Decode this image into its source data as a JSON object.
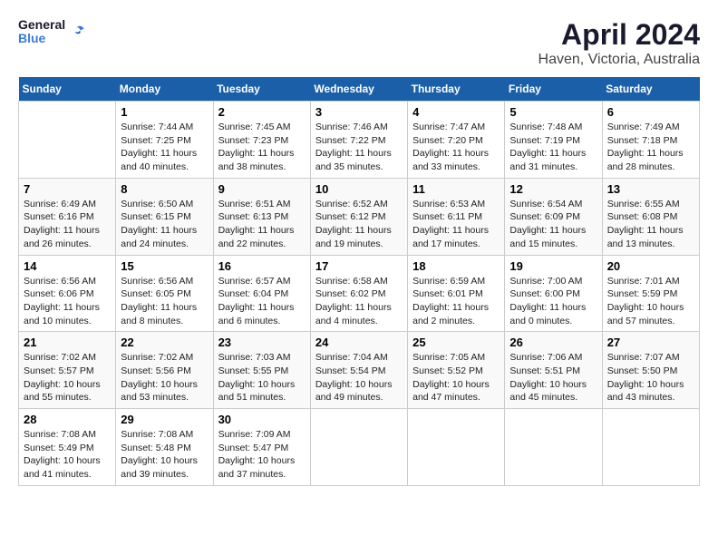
{
  "header": {
    "logo_line1": "General",
    "logo_line2": "Blue",
    "title": "April 2024",
    "subtitle": "Haven, Victoria, Australia"
  },
  "weekdays": [
    "Sunday",
    "Monday",
    "Tuesday",
    "Wednesday",
    "Thursday",
    "Friday",
    "Saturday"
  ],
  "weeks": [
    [
      {
        "day": "",
        "info": ""
      },
      {
        "day": "1",
        "info": "Sunrise: 7:44 AM\nSunset: 7:25 PM\nDaylight: 11 hours\nand 40 minutes."
      },
      {
        "day": "2",
        "info": "Sunrise: 7:45 AM\nSunset: 7:23 PM\nDaylight: 11 hours\nand 38 minutes."
      },
      {
        "day": "3",
        "info": "Sunrise: 7:46 AM\nSunset: 7:22 PM\nDaylight: 11 hours\nand 35 minutes."
      },
      {
        "day": "4",
        "info": "Sunrise: 7:47 AM\nSunset: 7:20 PM\nDaylight: 11 hours\nand 33 minutes."
      },
      {
        "day": "5",
        "info": "Sunrise: 7:48 AM\nSunset: 7:19 PM\nDaylight: 11 hours\nand 31 minutes."
      },
      {
        "day": "6",
        "info": "Sunrise: 7:49 AM\nSunset: 7:18 PM\nDaylight: 11 hours\nand 28 minutes."
      }
    ],
    [
      {
        "day": "7",
        "info": "Sunrise: 6:49 AM\nSunset: 6:16 PM\nDaylight: 11 hours\nand 26 minutes."
      },
      {
        "day": "8",
        "info": "Sunrise: 6:50 AM\nSunset: 6:15 PM\nDaylight: 11 hours\nand 24 minutes."
      },
      {
        "day": "9",
        "info": "Sunrise: 6:51 AM\nSunset: 6:13 PM\nDaylight: 11 hours\nand 22 minutes."
      },
      {
        "day": "10",
        "info": "Sunrise: 6:52 AM\nSunset: 6:12 PM\nDaylight: 11 hours\nand 19 minutes."
      },
      {
        "day": "11",
        "info": "Sunrise: 6:53 AM\nSunset: 6:11 PM\nDaylight: 11 hours\nand 17 minutes."
      },
      {
        "day": "12",
        "info": "Sunrise: 6:54 AM\nSunset: 6:09 PM\nDaylight: 11 hours\nand 15 minutes."
      },
      {
        "day": "13",
        "info": "Sunrise: 6:55 AM\nSunset: 6:08 PM\nDaylight: 11 hours\nand 13 minutes."
      }
    ],
    [
      {
        "day": "14",
        "info": "Sunrise: 6:56 AM\nSunset: 6:06 PM\nDaylight: 11 hours\nand 10 minutes."
      },
      {
        "day": "15",
        "info": "Sunrise: 6:56 AM\nSunset: 6:05 PM\nDaylight: 11 hours\nand 8 minutes."
      },
      {
        "day": "16",
        "info": "Sunrise: 6:57 AM\nSunset: 6:04 PM\nDaylight: 11 hours\nand 6 minutes."
      },
      {
        "day": "17",
        "info": "Sunrise: 6:58 AM\nSunset: 6:02 PM\nDaylight: 11 hours\nand 4 minutes."
      },
      {
        "day": "18",
        "info": "Sunrise: 6:59 AM\nSunset: 6:01 PM\nDaylight: 11 hours\nand 2 minutes."
      },
      {
        "day": "19",
        "info": "Sunrise: 7:00 AM\nSunset: 6:00 PM\nDaylight: 11 hours\nand 0 minutes."
      },
      {
        "day": "20",
        "info": "Sunrise: 7:01 AM\nSunset: 5:59 PM\nDaylight: 10 hours\nand 57 minutes."
      }
    ],
    [
      {
        "day": "21",
        "info": "Sunrise: 7:02 AM\nSunset: 5:57 PM\nDaylight: 10 hours\nand 55 minutes."
      },
      {
        "day": "22",
        "info": "Sunrise: 7:02 AM\nSunset: 5:56 PM\nDaylight: 10 hours\nand 53 minutes."
      },
      {
        "day": "23",
        "info": "Sunrise: 7:03 AM\nSunset: 5:55 PM\nDaylight: 10 hours\nand 51 minutes."
      },
      {
        "day": "24",
        "info": "Sunrise: 7:04 AM\nSunset: 5:54 PM\nDaylight: 10 hours\nand 49 minutes."
      },
      {
        "day": "25",
        "info": "Sunrise: 7:05 AM\nSunset: 5:52 PM\nDaylight: 10 hours\nand 47 minutes."
      },
      {
        "day": "26",
        "info": "Sunrise: 7:06 AM\nSunset: 5:51 PM\nDaylight: 10 hours\nand 45 minutes."
      },
      {
        "day": "27",
        "info": "Sunrise: 7:07 AM\nSunset: 5:50 PM\nDaylight: 10 hours\nand 43 minutes."
      }
    ],
    [
      {
        "day": "28",
        "info": "Sunrise: 7:08 AM\nSunset: 5:49 PM\nDaylight: 10 hours\nand 41 minutes."
      },
      {
        "day": "29",
        "info": "Sunrise: 7:08 AM\nSunset: 5:48 PM\nDaylight: 10 hours\nand 39 minutes."
      },
      {
        "day": "30",
        "info": "Sunrise: 7:09 AM\nSunset: 5:47 PM\nDaylight: 10 hours\nand 37 minutes."
      },
      {
        "day": "",
        "info": ""
      },
      {
        "day": "",
        "info": ""
      },
      {
        "day": "",
        "info": ""
      },
      {
        "day": "",
        "info": ""
      }
    ]
  ]
}
